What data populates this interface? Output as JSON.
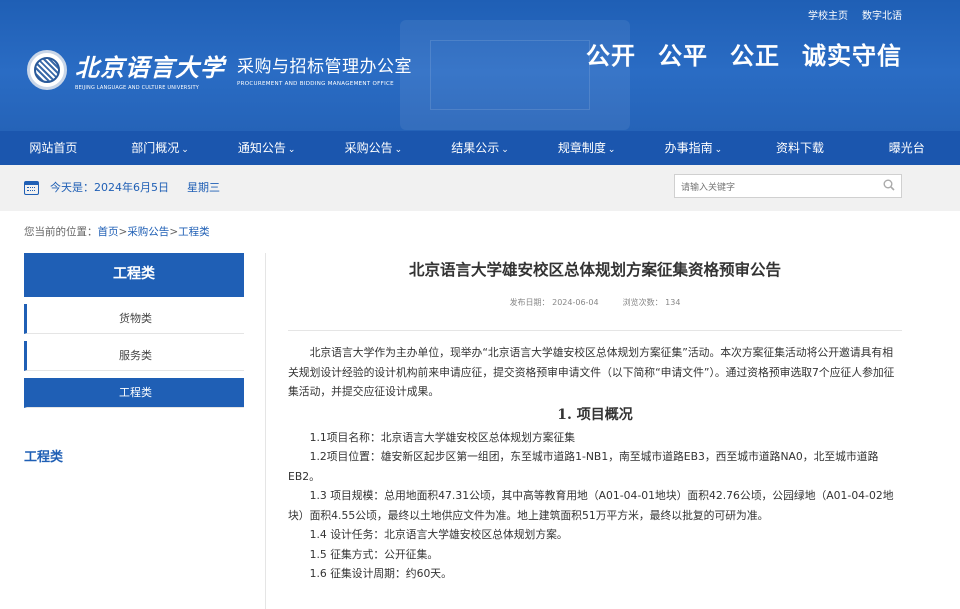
{
  "header": {
    "top_links": [
      "学校主页",
      "数字北语"
    ],
    "logo_cn": "北京语言大学",
    "logo_en": "BEIJING LANGUAGE AND CULTURE UNIVERSITY",
    "office_cn": "采购与招标管理办公室",
    "office_en": "PROCUREMENT AND BIDDING MANAGEMENT OFFICE",
    "slogans": [
      "公开",
      "公平",
      "公正",
      "诚实守信"
    ]
  },
  "nav": [
    {
      "label": "网站首页",
      "dropdown": false
    },
    {
      "label": "部门概况",
      "dropdown": true
    },
    {
      "label": "通知公告",
      "dropdown": true
    },
    {
      "label": "采购公告",
      "dropdown": true
    },
    {
      "label": "结果公示",
      "dropdown": true
    },
    {
      "label": "规章制度",
      "dropdown": true
    },
    {
      "label": "办事指南",
      "dropdown": true
    },
    {
      "label": "资料下载",
      "dropdown": false
    },
    {
      "label": "曝光台",
      "dropdown": false
    }
  ],
  "datebar": {
    "today": "今天是：2024年6月5日",
    "weekday": "星期三",
    "search_placeholder": "请输入关键字"
  },
  "breadcrumb": {
    "prefix": "您当前的位置：",
    "items": [
      "首页",
      "采购公告",
      "工程类"
    ],
    "separator": ">"
  },
  "sidebar": {
    "title": "工程类",
    "items": [
      {
        "label": "货物类",
        "active": false
      },
      {
        "label": "服务类",
        "active": false
      },
      {
        "label": "工程类",
        "active": true
      }
    ],
    "section_heading": "工程类"
  },
  "article": {
    "title": "北京语言大学雄安校区总体规划方案征集资格预审公告",
    "publish_date": "发布日期： 2024-06-04",
    "views": "浏览次数： 134",
    "intro": "北京语言大学作为主办单位，现举办“北京语言大学雄安校区总体规划方案征集”活动。本次方案征集活动将公开邀请具有相关规划设计经验的设计机构前来申请应征，提交资格预审申请文件（以下简称“申请文件”）。通过资格预审选取7个应征人参加征集活动，并提交应征设计成果。",
    "section1_title": "1. 项目概况",
    "items": [
      "1.1项目名称：北京语言大学雄安校区总体规划方案征集",
      "1.2项目位置：雄安新区起步区第一组团，东至城市道路1-NB1，南至城市道路EB3，西至城市道路NA0，北至城市道路EB2。",
      "1.3 项目规模：总用地面积47.31公顷，其中高等教育用地（A01-04-01地块）面积42.76公顷，公园绿地（A01-04-02地块）面积4.55公顷，最终以土地供应文件为准。地上建筑面积51万平方米，最终以批复的可研为准。",
      "1.4 设计任务：北京语言大学雄安校区总体规划方案。",
      "1.5 征集方式：公开征集。",
      "1.6 征集设计周期：约60天。"
    ]
  },
  "colors": {
    "primary": "#1f5fb5",
    "nav": "#1b56ae",
    "datebar": "#f1f1f1"
  }
}
